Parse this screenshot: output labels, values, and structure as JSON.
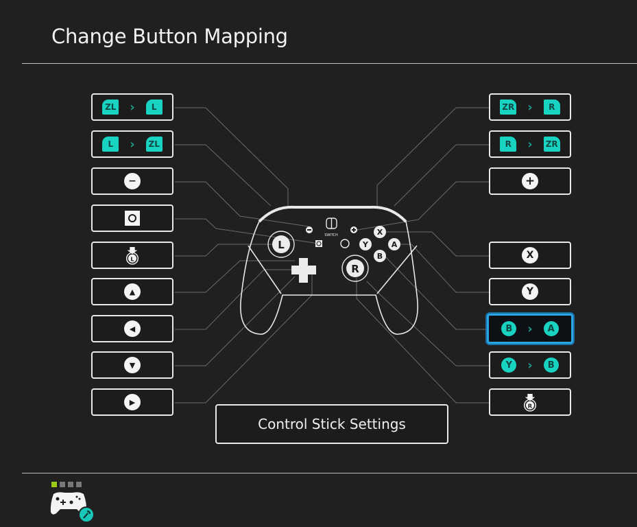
{
  "page": {
    "title": "Change Button Mapping",
    "control_stick_settings_label": "Control Stick Settings"
  },
  "colors": {
    "accent_teal": "#18d3c2",
    "selection_blue": "#2aa6e6",
    "active_indicator": "#9acd14"
  },
  "left_mappings": [
    {
      "id": "zl",
      "from": "ZL",
      "to": "L",
      "remapped": true
    },
    {
      "id": "l",
      "from": "L",
      "to": "ZL",
      "remapped": true
    },
    {
      "id": "minus",
      "icon": "minus-button-icon",
      "label": "−",
      "remapped": false
    },
    {
      "id": "capture",
      "icon": "capture-button-icon",
      "label": "",
      "remapped": false
    },
    {
      "id": "left-stick-press",
      "icon": "left-stick-press-icon",
      "label": "L",
      "remapped": false
    },
    {
      "id": "dpad-up",
      "icon": "dpad-up-icon",
      "label": "▲",
      "remapped": false
    },
    {
      "id": "dpad-left",
      "icon": "dpad-left-icon",
      "label": "◀",
      "remapped": false
    },
    {
      "id": "dpad-down",
      "icon": "dpad-down-icon",
      "label": "▼",
      "remapped": false
    },
    {
      "id": "dpad-right",
      "icon": "dpad-right-icon",
      "label": "▶",
      "remapped": false
    }
  ],
  "right_mappings": [
    {
      "id": "zr",
      "from": "ZR",
      "to": "R",
      "remapped": true
    },
    {
      "id": "r",
      "from": "R",
      "to": "ZR",
      "remapped": true
    },
    {
      "id": "plus",
      "icon": "plus-button-icon",
      "label": "+",
      "remapped": false
    },
    {
      "id": "x",
      "icon": "x-button-icon",
      "label": "X",
      "remapped": false
    },
    {
      "id": "y",
      "icon": "y-button-icon",
      "label": "Y",
      "remapped": false
    },
    {
      "id": "b",
      "from": "B",
      "to": "A",
      "remapped": true,
      "selected": true
    },
    {
      "id": "a",
      "from": "Y",
      "to": "B",
      "remapped": true
    },
    {
      "id": "right-stick-press",
      "icon": "right-stick-press-icon",
      "label": "R",
      "remapped": false
    }
  ],
  "controller": {
    "brand_text": "SWITCH",
    "left_stick_label": "L",
    "right_stick_label": "R",
    "face_buttons": [
      "X",
      "Y",
      "A",
      "B"
    ]
  },
  "footer": {
    "player_indicator": [
      true,
      false,
      false,
      false
    ]
  }
}
